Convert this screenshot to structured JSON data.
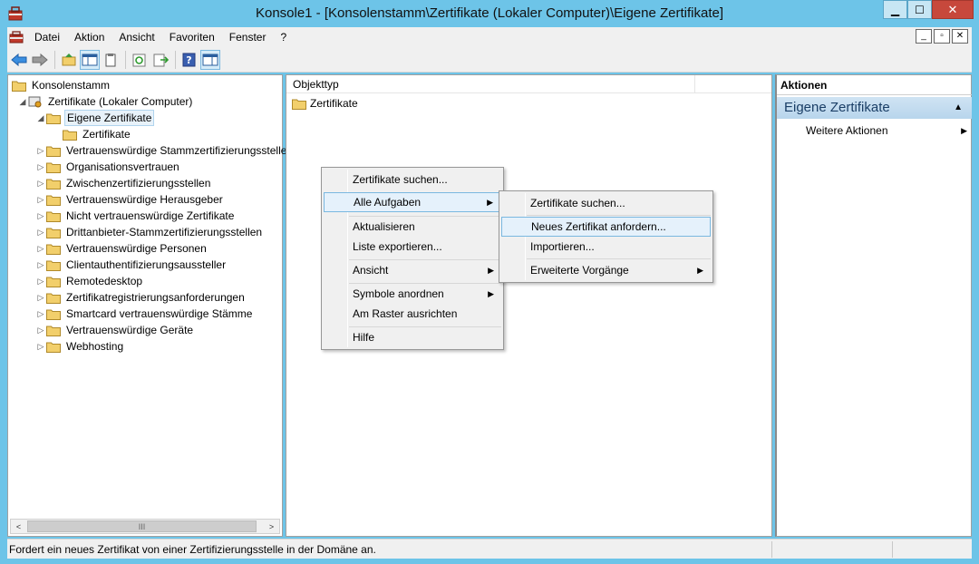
{
  "window": {
    "title": "Konsole1 - [Konsolenstamm\\Zertifikate (Lokaler Computer)\\Eigene Zertifikate]",
    "minimize": "▁",
    "maximize": "☐",
    "close": "✕"
  },
  "menubar": {
    "items": [
      "Datei",
      "Aktion",
      "Ansicht",
      "Favoriten",
      "Fenster",
      "?"
    ],
    "mdi": [
      "_",
      "▫",
      "✕"
    ]
  },
  "toolbar": {
    "icons": [
      "back-arrow-icon",
      "forward-arrow-icon",
      "up-folder-icon",
      "show-hide-tree-icon",
      "clipboard-icon",
      "refresh-icon",
      "export-list-icon",
      "help-icon",
      "action-pane-icon"
    ]
  },
  "tree": {
    "items": [
      {
        "label": "Konsolenstamm",
        "level": 0,
        "toggle": ""
      },
      {
        "label": "Zertifikate (Lokaler Computer)",
        "level": 1,
        "toggle": "◢"
      },
      {
        "label": "Eigene Zertifikate",
        "level": 2,
        "toggle": "◢",
        "selected": true
      },
      {
        "label": "Zertifikate",
        "level": 3,
        "toggle": ""
      },
      {
        "label": "Vertrauenswürdige Stammzertifizierungsstelle",
        "level": 2,
        "toggle": "▷"
      },
      {
        "label": "Organisationsvertrauen",
        "level": 2,
        "toggle": "▷"
      },
      {
        "label": "Zwischenzertifizierungsstellen",
        "level": 2,
        "toggle": "▷"
      },
      {
        "label": "Vertrauenswürdige Herausgeber",
        "level": 2,
        "toggle": "▷"
      },
      {
        "label": "Nicht vertrauenswürdige Zertifikate",
        "level": 2,
        "toggle": "▷"
      },
      {
        "label": "Drittanbieter-Stammzertifizierungsstellen",
        "level": 2,
        "toggle": "▷"
      },
      {
        "label": "Vertrauenswürdige Personen",
        "level": 2,
        "toggle": "▷"
      },
      {
        "label": "Clientauthentifizierungsaussteller",
        "level": 2,
        "toggle": "▷"
      },
      {
        "label": "Remotedesktop",
        "level": 2,
        "toggle": "▷"
      },
      {
        "label": "Zertifikatregistrierungsanforderungen",
        "level": 2,
        "toggle": "▷"
      },
      {
        "label": "Smartcard vertrauenswürdige Stämme",
        "level": 2,
        "toggle": "▷"
      },
      {
        "label": "Vertrauenswürdige Geräte",
        "level": 2,
        "toggle": "▷"
      },
      {
        "label": "Webhosting",
        "level": 2,
        "toggle": "▷"
      }
    ],
    "scroll_left": "<",
    "scroll_right": ">",
    "scroll_thumb": "III"
  },
  "list": {
    "column": "Objekttyp",
    "rows": [
      "Zertifikate"
    ]
  },
  "actions": {
    "header": "Aktionen",
    "section": "Eigene Zertifikate",
    "collapse": "▲",
    "items": [
      {
        "label": "Weitere Aktionen",
        "arrow": "▶"
      }
    ]
  },
  "context_menu": {
    "items": [
      {
        "label": "Zertifikate suchen...",
        "arrow": ""
      },
      {
        "label": "Alle Aufgaben",
        "arrow": "▶",
        "highlighted": true
      },
      {
        "label": "Aktualisieren",
        "arrow": ""
      },
      {
        "label": "Liste exportieren...",
        "arrow": ""
      },
      {
        "label": "Ansicht",
        "arrow": "▶"
      },
      {
        "label": "Symbole anordnen",
        "arrow": "▶"
      },
      {
        "label": "Am Raster ausrichten",
        "arrow": ""
      },
      {
        "label": "Hilfe",
        "arrow": ""
      }
    ]
  },
  "submenu": {
    "items": [
      {
        "label": "Zertifikate suchen...",
        "arrow": ""
      },
      {
        "label": "Neues Zertifikat anfordern...",
        "arrow": "",
        "highlighted": true
      },
      {
        "label": "Importieren...",
        "arrow": ""
      },
      {
        "label": "Erweiterte Vorgänge",
        "arrow": "▶"
      }
    ]
  },
  "status": {
    "text": "Fordert ein neues Zertifikat von einer Zertifizierungsstelle in der Domäne an."
  },
  "colors": {
    "frame": "#6dc4e8",
    "highlight": "#e5f1fb",
    "highlight_border": "#7ab8e0",
    "folder": "#f2cf6b"
  }
}
